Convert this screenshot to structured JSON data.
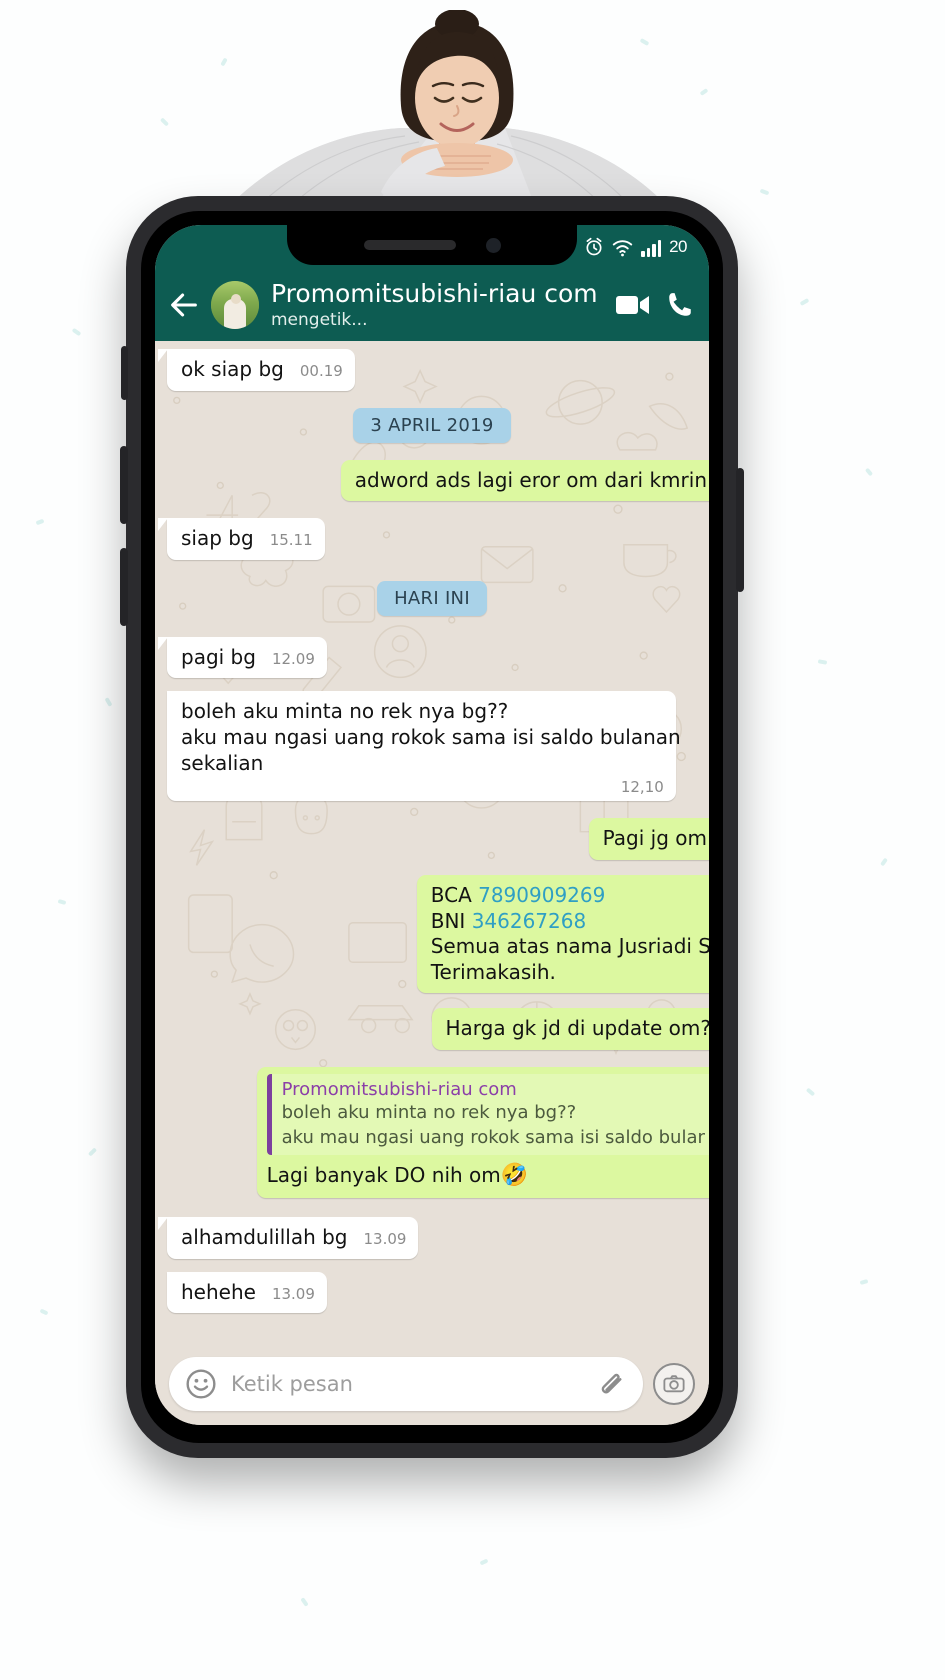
{
  "statusbar": {
    "icons": [
      "alarm-icon",
      "wifi-icon",
      "signal-icon"
    ],
    "battery": "20"
  },
  "header": {
    "back_icon": "back-arrow-icon",
    "avatar": "contact-avatar",
    "title": "Promomitsubishi-riau com",
    "subtitle": "mengetik...",
    "video_call_icon": "video-call-icon",
    "voice_call_icon": "phone-call-icon"
  },
  "messages": [
    {
      "kind": "in",
      "text": "ok siap bg",
      "time": "00.19"
    },
    {
      "kind": "divider",
      "text": "3 APRIL 2019"
    },
    {
      "kind": "out",
      "text": "adword ads lagi eror om dari kmrin"
    },
    {
      "kind": "in",
      "text": "siap bg",
      "time": "15.11"
    },
    {
      "kind": "divider",
      "text": "HARI INI"
    },
    {
      "kind": "in",
      "text": "pagi bg",
      "time": "12.09"
    },
    {
      "kind": "in_block",
      "line1": "boleh aku minta no rek nya bg??",
      "line2": "aku mau ngasi uang rokok sama isi saldo bulanan",
      "line3": "sekalian",
      "time": "12,10"
    },
    {
      "kind": "out",
      "text": "Pagi jg om"
    },
    {
      "kind": "out_acct",
      "bca_label": "BCA",
      "bca_number": "7890909269",
      "bni_label": "BNI",
      "bni_number": "346267268",
      "line3": "Semua atas nama Jusriadi S",
      "line4": "Terimakasih."
    },
    {
      "kind": "out",
      "text": "Harga gk jd di update om?"
    },
    {
      "kind": "out_quote",
      "quote_name": "Promomitsubishi-riau com",
      "quote_line1": "boleh aku minta no rek nya bg??",
      "quote_line2": "aku mau ngasi uang rokok sama isi saldo bulanan s",
      "text": "Lagi banyak DO nih om",
      "emoji": "🤣"
    },
    {
      "kind": "in",
      "text": "alhamdulillah bg",
      "time": "13.09"
    },
    {
      "kind": "in",
      "text": "hehehe",
      "time": "13.09"
    }
  ],
  "input": {
    "emoji_icon": "emoji-smiley-icon",
    "placeholder": "Ketik pesan",
    "attach_icon": "paperclip-icon",
    "camera_icon": "camera-icon"
  },
  "colors": {
    "header_green": "#0d5c52",
    "outgoing_bubble": "#dcf8a0",
    "incoming_bubble": "#ffffff",
    "divider_blue": "#a9d2e8",
    "link_blue": "#2f9fc4",
    "quote_purple": "#8b3fa8"
  }
}
